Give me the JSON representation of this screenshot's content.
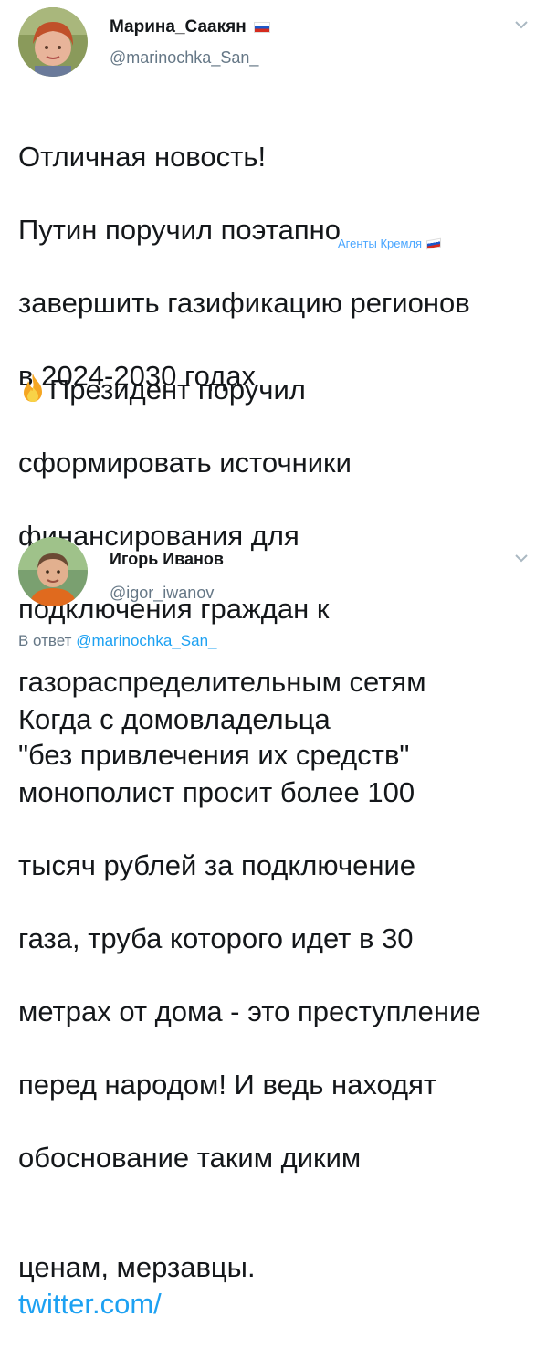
{
  "tweet1": {
    "author_name": "Марина_Саакян",
    "handle": "@marinochka_San_",
    "lines": [
      "Отличная новость!",
      "Путин поручил поэтапно",
      "завершить газификацию регионов",
      "в 2024-2030 годах"
    ],
    "watermark": "Агенты Кремля",
    "lines2": [
      "Президент поручил",
      "сформировать источники",
      "финансирования для",
      "подключения граждан к",
      "газораспределительным сетям",
      "\"без привлечения их средств\""
    ]
  },
  "tweet2": {
    "author_name": "Игорь Иванов",
    "handle": "@igor_iwanov",
    "reply_prefix": "В ответ",
    "reply_handle": "@marinochka_San_",
    "lines": [
      "Когда с домовладельца",
      "монополист просит более 100",
      "тысяч рублей за подключение",
      "газа, труба которого идет в 30",
      "метрах от дома - это преступление",
      "перед народом! И ведь находят",
      "обоснование таким диким"
    ],
    "last_line_text": "ценам, мерзавцы.",
    "link": "twitter.com/"
  },
  "colors": {
    "link": "#1da1f2",
    "muted": "#657786",
    "watermark": "#4aa6ff"
  },
  "icons": [
    "russia-flag-icon",
    "chevron-down-icon",
    "fire-icon"
  ]
}
